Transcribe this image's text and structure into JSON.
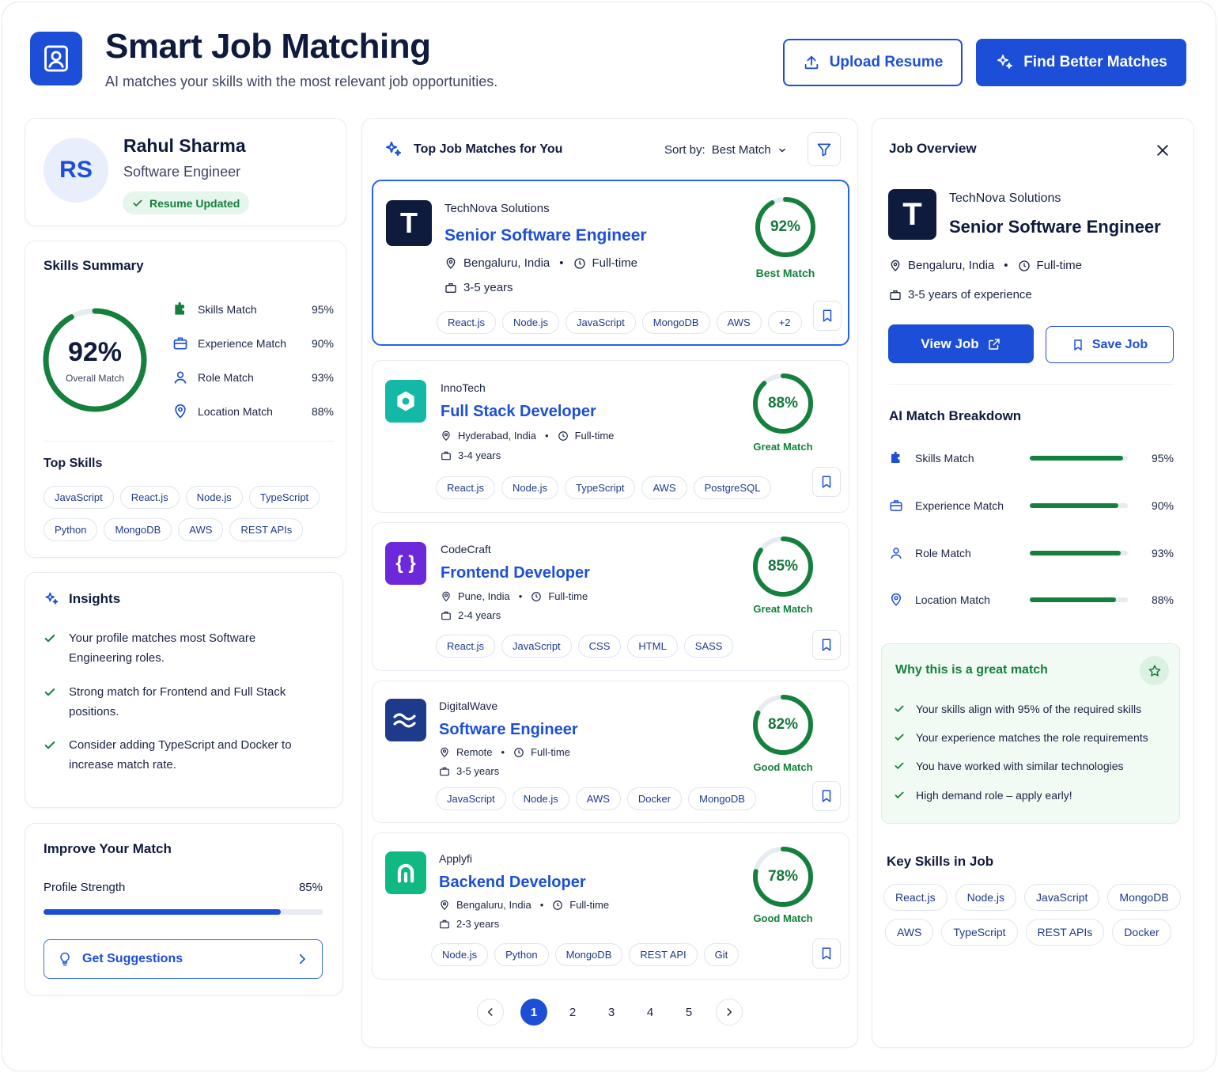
{
  "header": {
    "title": "Smart Job Matching",
    "subtitle": "AI matches your skills with the most relevant job opportunities.",
    "upload_label": "Upload Resume",
    "find_label": "Find Better Matches"
  },
  "profile": {
    "initials": "RS",
    "name": "Rahul Sharma",
    "role": "Software Engineer",
    "badge": "Resume Updated"
  },
  "skills_summary": {
    "title": "Skills Summary",
    "overall_value": 92,
    "overall_text": "92%",
    "overall_label": "Overall Match",
    "metrics": [
      {
        "label": "Skills Match",
        "value": "95%",
        "icon": "puzzle-icon"
      },
      {
        "label": "Experience Match",
        "value": "90%",
        "icon": "briefcase-icon"
      },
      {
        "label": "Role Match",
        "value": "93%",
        "icon": "person-icon"
      },
      {
        "label": "Location Match",
        "value": "88%",
        "icon": "location-pin-icon"
      }
    ],
    "top_skills_title": "Top Skills",
    "top_skills": [
      "JavaScript",
      "React.js",
      "Node.js",
      "TypeScript",
      "Python",
      "MongoDB",
      "AWS",
      "REST APIs"
    ]
  },
  "insights": {
    "title": "Insights",
    "items": [
      "Your profile matches most Software Engineering roles.",
      "Strong match for Frontend and Full Stack positions.",
      "Consider adding TypeScript and Docker to increase match rate."
    ]
  },
  "improve": {
    "title": "Improve Your Match",
    "strength_label": "Profile Strength",
    "strength_text": "85%",
    "strength_value": 85,
    "suggest_label": "Get Suggestions"
  },
  "matches": {
    "title": "Top Job Matches for You",
    "sort_prefix": "Sort by:",
    "sort_value": "Best Match",
    "jobs": [
      {
        "company": "TechNova Solutions",
        "title": "Senior Software Engineer",
        "location": "Bengaluru, India",
        "type": "Full-time",
        "experience": "3-5 years",
        "score": 92,
        "score_text": "92%",
        "match_label": "Best Match",
        "tags": [
          "React.js",
          "Node.js",
          "JavaScript",
          "MongoDB",
          "AWS",
          "+2"
        ],
        "logo": "T",
        "logo_color": "#0f1b3d"
      },
      {
        "company": "InnoTech",
        "title": "Full Stack Developer",
        "location": "Hyderabad, India",
        "type": "Full-time",
        "experience": "3-4 years",
        "score": 88,
        "score_text": "88%",
        "match_label": "Great Match",
        "tags": [
          "React.js",
          "Node.js",
          "TypeScript",
          "AWS",
          "PostgreSQL"
        ],
        "logo": "hexagon",
        "logo_color": "#14b8a6"
      },
      {
        "company": "CodeCraft",
        "title": "Frontend Developer",
        "location": "Pune, India",
        "type": "Full-time",
        "experience": "2-4 years",
        "score": 85,
        "score_text": "85%",
        "match_label": "Great Match",
        "tags": [
          "React.js",
          "JavaScript",
          "CSS",
          "HTML",
          "SASS"
        ],
        "logo": "{ }",
        "logo_color": "#6d28d9"
      },
      {
        "company": "DigitalWave",
        "title": "Software Engineer",
        "location": "Remote",
        "type": "Full-time",
        "experience": "3-5 years",
        "score": 82,
        "score_text": "82%",
        "match_label": "Good Match",
        "tags": [
          "JavaScript",
          "Node.js",
          "AWS",
          "Docker",
          "MongoDB"
        ],
        "logo": "waves",
        "logo_color": "#1e3a8a"
      },
      {
        "company": "Applyfi",
        "title": "Backend Developer",
        "location": "Bengaluru, India",
        "type": "Full-time",
        "experience": "2-3 years",
        "score": 78,
        "score_text": "78%",
        "match_label": "Good Match",
        "tags": [
          "Node.js",
          "Python",
          "MongoDB",
          "REST API",
          "Git"
        ],
        "logo": "A",
        "logo_color": "#10b981"
      }
    ],
    "pages": [
      "1",
      "2",
      "3",
      "4",
      "5"
    ]
  },
  "overview": {
    "title": "Job Overview",
    "company": "TechNova Solutions",
    "logo": "T",
    "job_title": "Senior Software Engineer",
    "location": "Bengaluru, India",
    "type": "Full-time",
    "experience": "3-5 years of experience",
    "view_label": "View Job",
    "save_label": "Save Job",
    "breakdown_title": "AI Match Breakdown",
    "breakdown": [
      {
        "label": "Skills Match",
        "value": 95,
        "text": "95%",
        "icon": "puzzle-icon"
      },
      {
        "label": "Experience Match",
        "value": 90,
        "text": "90%",
        "icon": "briefcase-icon"
      },
      {
        "label": "Role Match",
        "value": 93,
        "text": "93%",
        "icon": "person-icon"
      },
      {
        "label": "Location Match",
        "value": 88,
        "text": "88%",
        "icon": "location-pin-icon"
      }
    ],
    "why_title": "Why this is a great match",
    "why_items": [
      "Your skills align with 95% of the required skills",
      "Your experience matches the role requirements",
      "You have worked with similar technologies",
      "High demand role – apply early!"
    ],
    "key_skills_title": "Key Skills in Job",
    "key_skills": [
      "React.js",
      "Node.js",
      "JavaScript",
      "MongoDB",
      "AWS",
      "TypeScript",
      "REST APIs",
      "Docker"
    ]
  },
  "colors": {
    "primary": "#1d4ed8",
    "success": "#15803d",
    "ring_track": "#e6ebf2"
  }
}
